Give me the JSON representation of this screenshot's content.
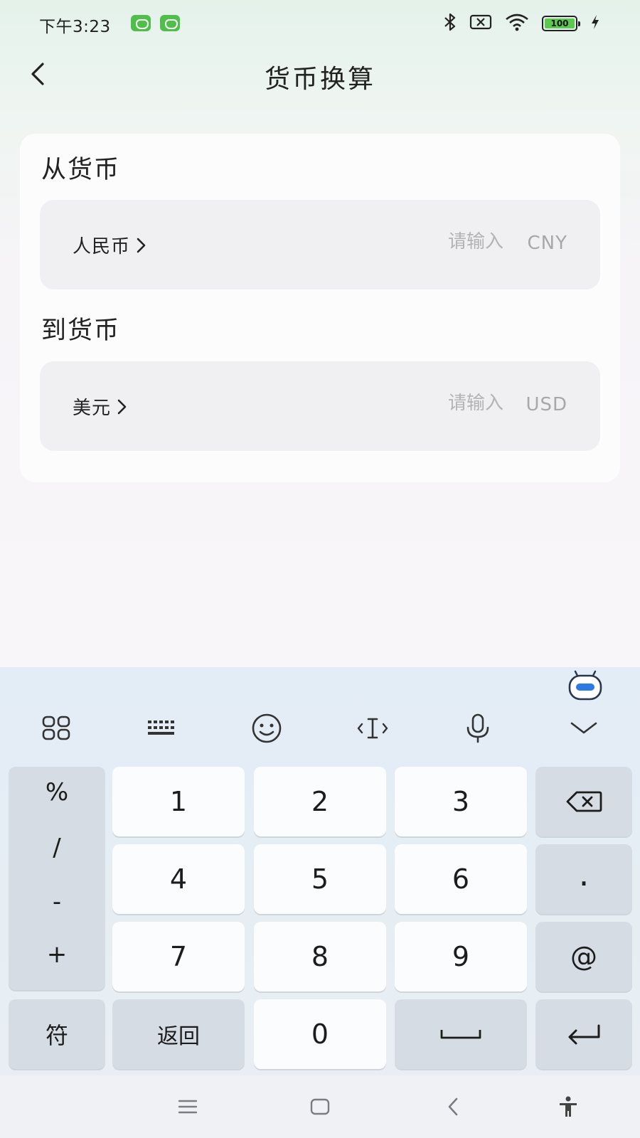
{
  "status_bar": {
    "time": "下午3:23",
    "battery_level": "100",
    "icons": [
      "app-notification-icon",
      "app-notification-icon",
      "bluetooth-icon",
      "sim-off-icon",
      "wifi-icon",
      "battery-icon",
      "charging-icon"
    ]
  },
  "header": {
    "title": "货币换算",
    "back_icon": "chevron-left-icon"
  },
  "from": {
    "section_title": "从货币",
    "currency_name": "人民币",
    "placeholder": "请输入",
    "value": "",
    "currency_code": "CNY"
  },
  "to": {
    "section_title": "到货币",
    "currency_name": "美元",
    "placeholder": "请输入",
    "value": "",
    "currency_code": "USD"
  },
  "keyboard": {
    "toolbar": [
      "grid-menu-icon",
      "keyboard-icon",
      "emoji-icon",
      "cursor-icon",
      "microphone-icon",
      "collapse-icon"
    ],
    "symbols": [
      "%",
      "/",
      "-",
      "+"
    ],
    "digits": [
      "1",
      "2",
      "3",
      "4",
      "5",
      "6",
      "7",
      "8",
      "9",
      "0"
    ],
    "dot": ".",
    "at": "@",
    "fu_label": "符",
    "back_label": "返回",
    "icons": [
      "backspace-icon",
      "space-icon",
      "enter-icon"
    ]
  },
  "nav_bar": {
    "icons": [
      "menu-icon",
      "home-icon",
      "back-icon",
      "accessibility-icon"
    ]
  },
  "colors": {
    "badge_green": "#4fbf4a",
    "card_bg": "#fdfcfd",
    "row_bg": "#f0eff2",
    "placeholder": "#b3b3b5",
    "key_light": "#fbfcfd",
    "key_dark": "#d6dce3"
  }
}
